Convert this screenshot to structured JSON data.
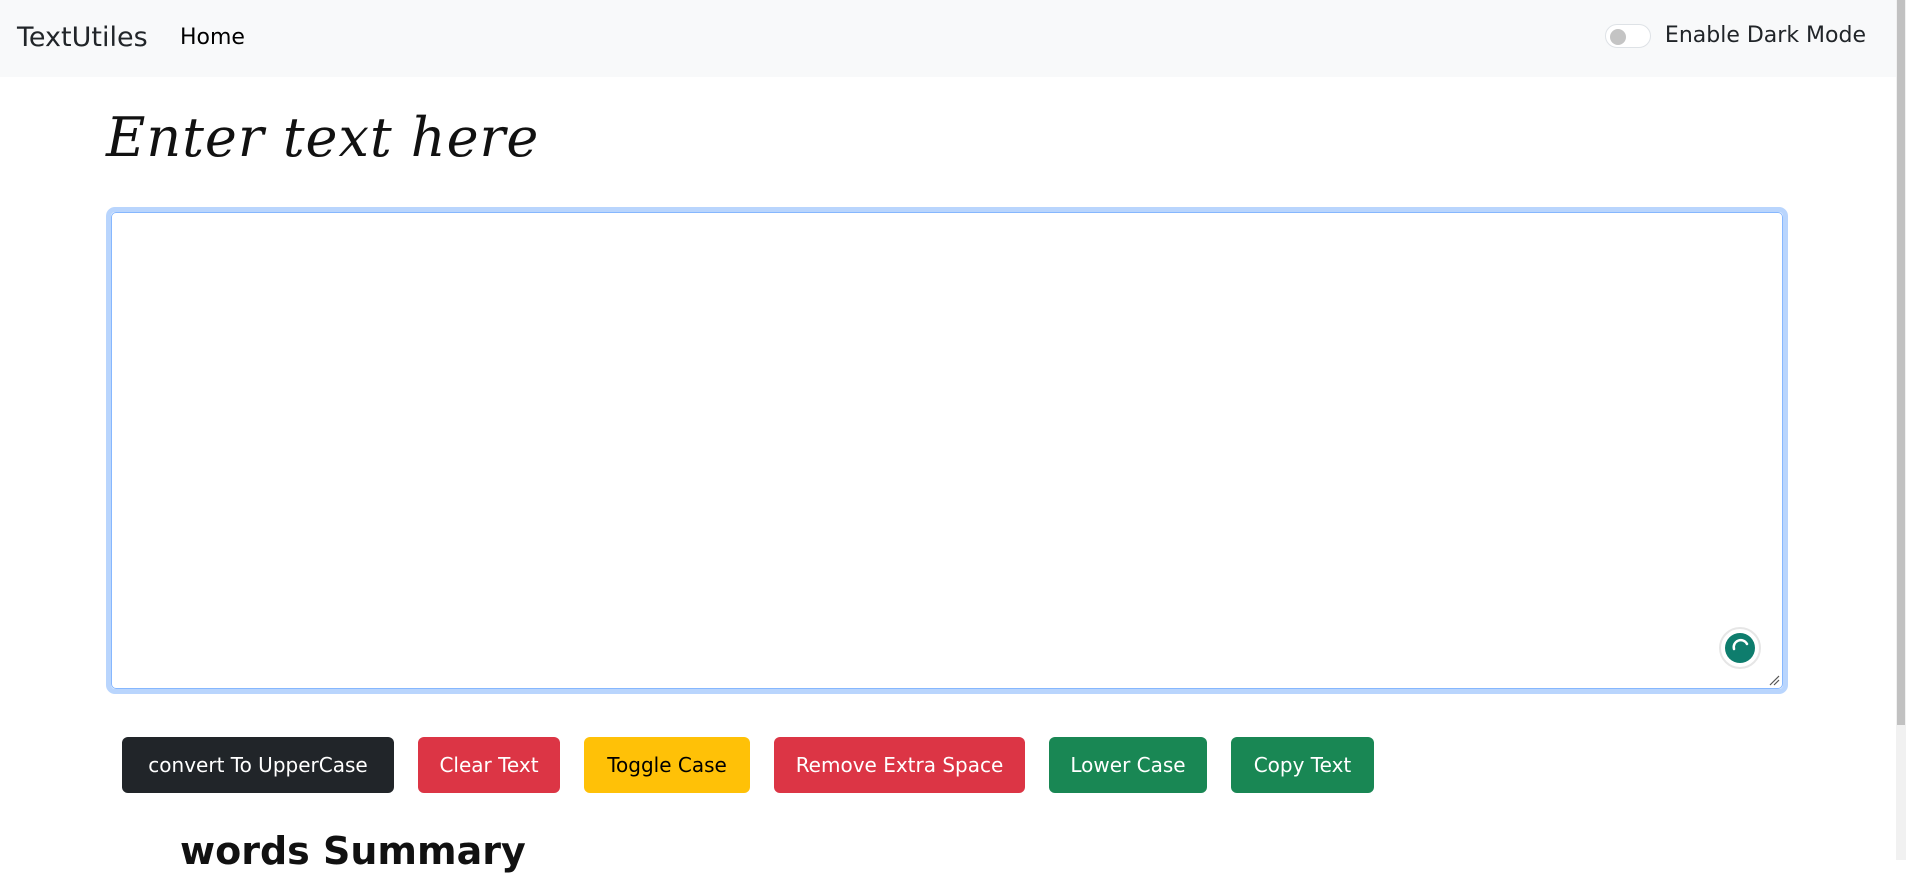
{
  "navbar": {
    "brand": "TextUtiles",
    "home_label": "Home",
    "dark_mode_label": "Enable Dark Mode",
    "dark_mode_enabled": false
  },
  "main": {
    "heading": "Enter text here",
    "textarea_value": ""
  },
  "buttons": {
    "uppercase": "convert To UpperCase",
    "clear": "Clear Text",
    "toggle": "Toggle Case",
    "remove_space": "Remove Extra Space",
    "lower": "Lower Case",
    "copy": "Copy Text"
  },
  "summary": {
    "heading": "words Summary"
  },
  "colors": {
    "navbar_bg": "#f8f9fa",
    "dark": "#212529",
    "danger": "#dc3545",
    "warning": "#ffc107",
    "success": "#198754",
    "focus_ring": "#b9d5fd",
    "grammar_icon": "#0e7d6d"
  },
  "icons": {
    "grammar_assistant": "grammar-assistant-icon",
    "resize": "resize-handle-icon"
  }
}
